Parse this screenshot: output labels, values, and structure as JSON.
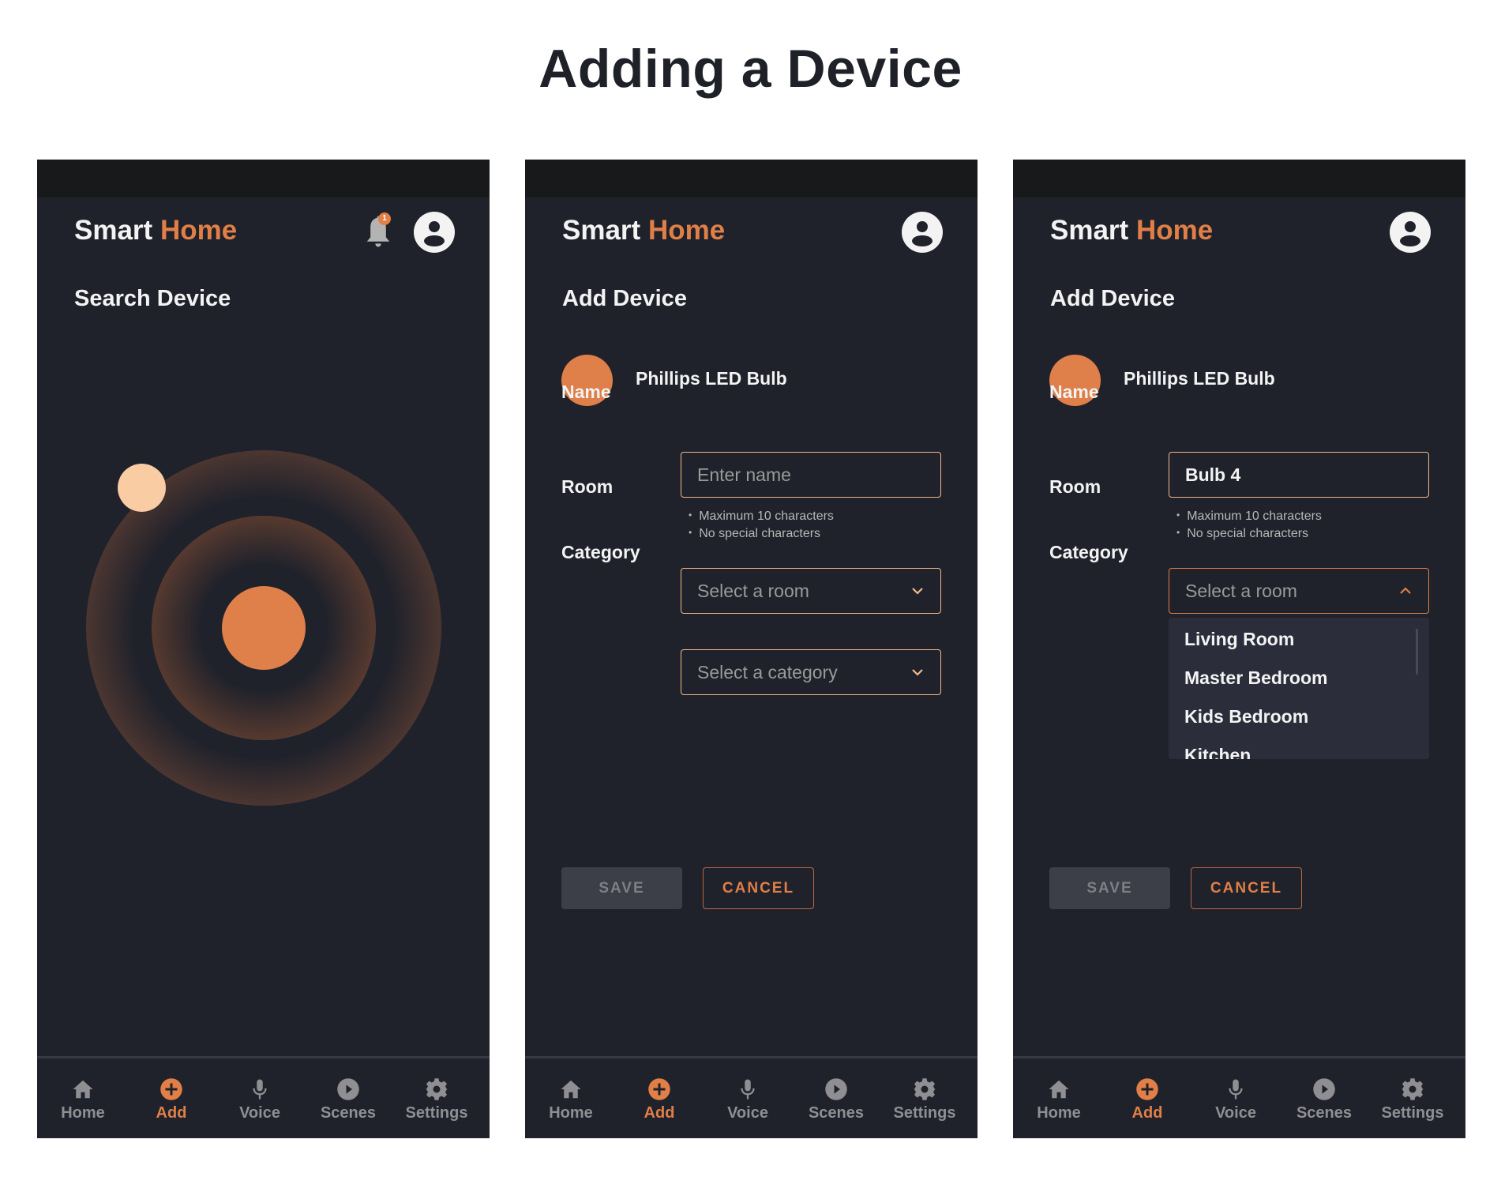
{
  "page_title": "Adding a Device",
  "colors": {
    "accent": "#e07f47",
    "background": "#20222b",
    "status_bar": "#18191b",
    "found_device": "#f9cca4"
  },
  "app": {
    "title_part1": "Smart",
    "title_part2": "Home"
  },
  "screens": [
    {
      "section_title": "Search Device",
      "notification_count": "1",
      "icons": [
        "bell-icon",
        "account-icon"
      ]
    },
    {
      "section_title": "Add Device",
      "device_name": "Phillips LED Bulb",
      "fields": {
        "name_label": "Name",
        "name_value": "",
        "name_placeholder": "Enter name",
        "hints": [
          "Maximum 10 characters",
          "No special characters"
        ],
        "room_label": "Room",
        "room_placeholder": "Select a room",
        "category_label": "Category",
        "category_placeholder": "Select a category"
      },
      "buttons": {
        "save": "SAVE",
        "cancel": "CANCEL"
      }
    },
    {
      "section_title": "Add Device",
      "device_name": "Phillips LED Bulb",
      "fields": {
        "name_label": "Name",
        "name_value": "Bulb 4",
        "hints": [
          "Maximum 10 characters",
          "No special characters"
        ],
        "room_label": "Room",
        "room_placeholder": "Select a room",
        "room_options": [
          "Living Room",
          "Master Bedroom",
          "Kids Bedroom",
          "Kitchen"
        ],
        "category_label": "Category"
      },
      "buttons": {
        "save": "SAVE",
        "cancel": "CANCEL"
      }
    }
  ],
  "nav": {
    "items": [
      {
        "label": "Home",
        "icon": "home-icon"
      },
      {
        "label": "Add",
        "icon": "add-circle-icon",
        "active": true
      },
      {
        "label": "Voice",
        "icon": "microphone-icon"
      },
      {
        "label": "Scenes",
        "icon": "play-circle-icon"
      },
      {
        "label": "Settings",
        "icon": "gear-icon"
      }
    ]
  }
}
